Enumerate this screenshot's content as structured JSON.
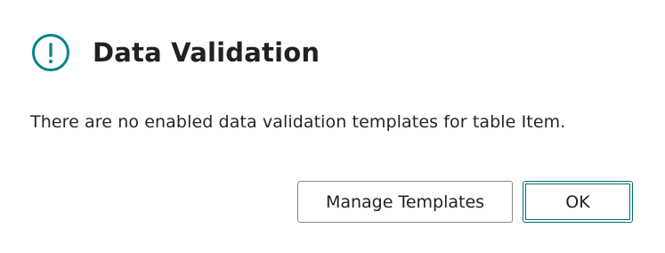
{
  "dialog": {
    "icon": "exclamation-circle-icon",
    "accent_color": "#00838a",
    "title": "Data Validation",
    "message": "There are no enabled data validation templates for table Item.",
    "buttons": {
      "manage_templates_label": "Manage Templates",
      "ok_label": "OK"
    }
  }
}
